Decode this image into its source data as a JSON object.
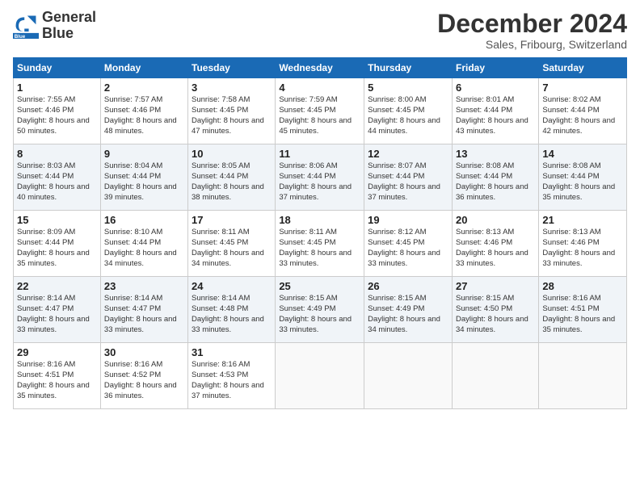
{
  "logo": {
    "line1": "General",
    "line2": "Blue"
  },
  "title": "December 2024",
  "location": "Sales, Fribourg, Switzerland",
  "days_of_week": [
    "Sunday",
    "Monday",
    "Tuesday",
    "Wednesday",
    "Thursday",
    "Friday",
    "Saturday"
  ],
  "weeks": [
    [
      {
        "day": "1",
        "sunrise": "7:55 AM",
        "sunset": "4:46 PM",
        "daylight": "8 hours and 50 minutes."
      },
      {
        "day": "2",
        "sunrise": "7:57 AM",
        "sunset": "4:46 PM",
        "daylight": "8 hours and 48 minutes."
      },
      {
        "day": "3",
        "sunrise": "7:58 AM",
        "sunset": "4:45 PM",
        "daylight": "8 hours and 47 minutes."
      },
      {
        "day": "4",
        "sunrise": "7:59 AM",
        "sunset": "4:45 PM",
        "daylight": "8 hours and 45 minutes."
      },
      {
        "day": "5",
        "sunrise": "8:00 AM",
        "sunset": "4:45 PM",
        "daylight": "8 hours and 44 minutes."
      },
      {
        "day": "6",
        "sunrise": "8:01 AM",
        "sunset": "4:44 PM",
        "daylight": "8 hours and 43 minutes."
      },
      {
        "day": "7",
        "sunrise": "8:02 AM",
        "sunset": "4:44 PM",
        "daylight": "8 hours and 42 minutes."
      }
    ],
    [
      {
        "day": "8",
        "sunrise": "8:03 AM",
        "sunset": "4:44 PM",
        "daylight": "8 hours and 40 minutes."
      },
      {
        "day": "9",
        "sunrise": "8:04 AM",
        "sunset": "4:44 PM",
        "daylight": "8 hours and 39 minutes."
      },
      {
        "day": "10",
        "sunrise": "8:05 AM",
        "sunset": "4:44 PM",
        "daylight": "8 hours and 38 minutes."
      },
      {
        "day": "11",
        "sunrise": "8:06 AM",
        "sunset": "4:44 PM",
        "daylight": "8 hours and 37 minutes."
      },
      {
        "day": "12",
        "sunrise": "8:07 AM",
        "sunset": "4:44 PM",
        "daylight": "8 hours and 37 minutes."
      },
      {
        "day": "13",
        "sunrise": "8:08 AM",
        "sunset": "4:44 PM",
        "daylight": "8 hours and 36 minutes."
      },
      {
        "day": "14",
        "sunrise": "8:08 AM",
        "sunset": "4:44 PM",
        "daylight": "8 hours and 35 minutes."
      }
    ],
    [
      {
        "day": "15",
        "sunrise": "8:09 AM",
        "sunset": "4:44 PM",
        "daylight": "8 hours and 35 minutes."
      },
      {
        "day": "16",
        "sunrise": "8:10 AM",
        "sunset": "4:44 PM",
        "daylight": "8 hours and 34 minutes."
      },
      {
        "day": "17",
        "sunrise": "8:11 AM",
        "sunset": "4:45 PM",
        "daylight": "8 hours and 34 minutes."
      },
      {
        "day": "18",
        "sunrise": "8:11 AM",
        "sunset": "4:45 PM",
        "daylight": "8 hours and 33 minutes."
      },
      {
        "day": "19",
        "sunrise": "8:12 AM",
        "sunset": "4:45 PM",
        "daylight": "8 hours and 33 minutes."
      },
      {
        "day": "20",
        "sunrise": "8:13 AM",
        "sunset": "4:46 PM",
        "daylight": "8 hours and 33 minutes."
      },
      {
        "day": "21",
        "sunrise": "8:13 AM",
        "sunset": "4:46 PM",
        "daylight": "8 hours and 33 minutes."
      }
    ],
    [
      {
        "day": "22",
        "sunrise": "8:14 AM",
        "sunset": "4:47 PM",
        "daylight": "8 hours and 33 minutes."
      },
      {
        "day": "23",
        "sunrise": "8:14 AM",
        "sunset": "4:47 PM",
        "daylight": "8 hours and 33 minutes."
      },
      {
        "day": "24",
        "sunrise": "8:14 AM",
        "sunset": "4:48 PM",
        "daylight": "8 hours and 33 minutes."
      },
      {
        "day": "25",
        "sunrise": "8:15 AM",
        "sunset": "4:49 PM",
        "daylight": "8 hours and 33 minutes."
      },
      {
        "day": "26",
        "sunrise": "8:15 AM",
        "sunset": "4:49 PM",
        "daylight": "8 hours and 34 minutes."
      },
      {
        "day": "27",
        "sunrise": "8:15 AM",
        "sunset": "4:50 PM",
        "daylight": "8 hours and 34 minutes."
      },
      {
        "day": "28",
        "sunrise": "8:16 AM",
        "sunset": "4:51 PM",
        "daylight": "8 hours and 35 minutes."
      }
    ],
    [
      {
        "day": "29",
        "sunrise": "8:16 AM",
        "sunset": "4:51 PM",
        "daylight": "8 hours and 35 minutes."
      },
      {
        "day": "30",
        "sunrise": "8:16 AM",
        "sunset": "4:52 PM",
        "daylight": "8 hours and 36 minutes."
      },
      {
        "day": "31",
        "sunrise": "8:16 AM",
        "sunset": "4:53 PM",
        "daylight": "8 hours and 37 minutes."
      },
      null,
      null,
      null,
      null
    ]
  ]
}
